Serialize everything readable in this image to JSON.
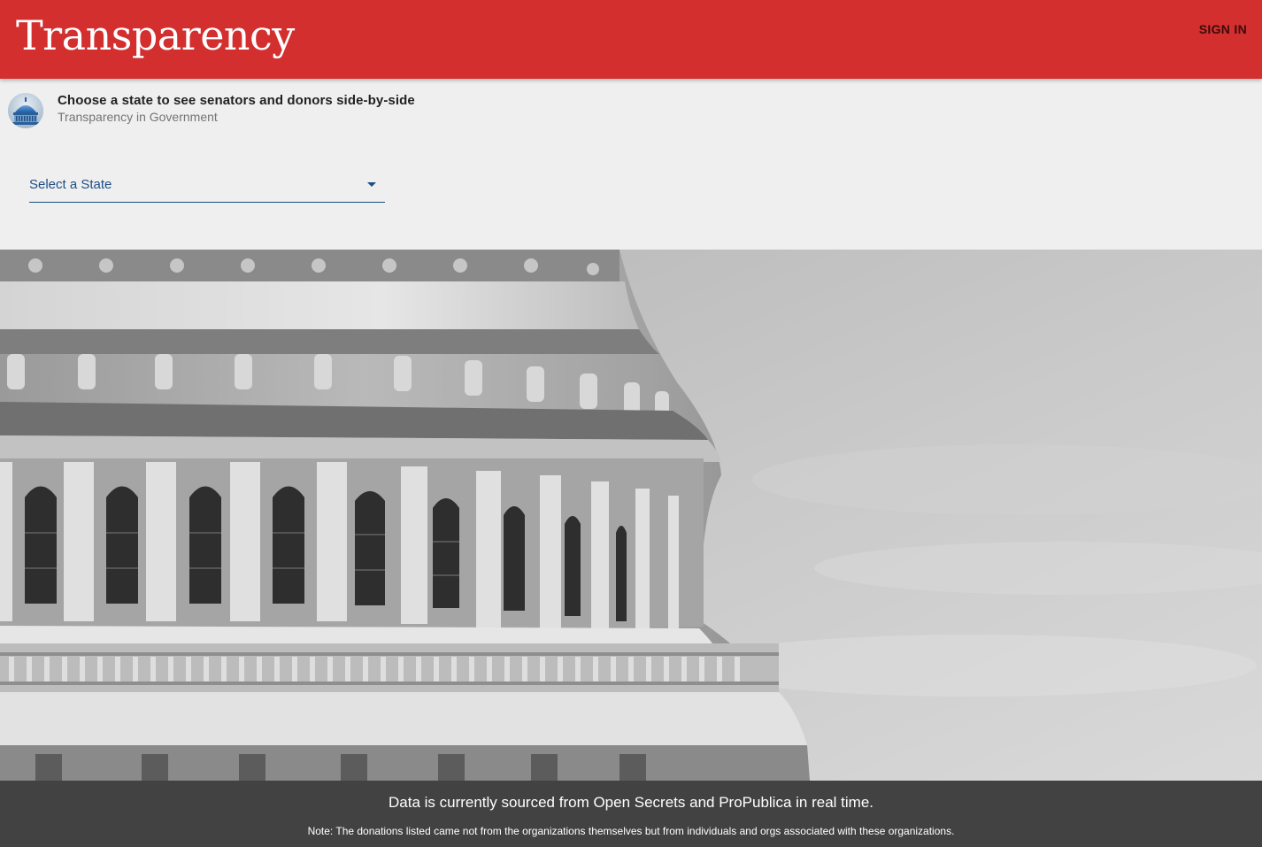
{
  "header": {
    "brand": "Transparency",
    "sign_in_label": "SIGN IN",
    "color": "#d32f2f"
  },
  "card": {
    "title": "Choose a state to see senators and donors side-by-side",
    "subtitle": "Transparency in Government",
    "avatar_icon": "capitol-dome-icon"
  },
  "state_select": {
    "placeholder": "Select a State",
    "accent": "#1c4e86"
  },
  "hero": {
    "image": "capitol-dome-photo"
  },
  "footer": {
    "main_text": "Data is currently sourced from Open Secrets and ProPublica in real time.",
    "note_text": "Note: The donations listed came not from the organizations themselves but from individuals and orgs associated with these organizations."
  }
}
